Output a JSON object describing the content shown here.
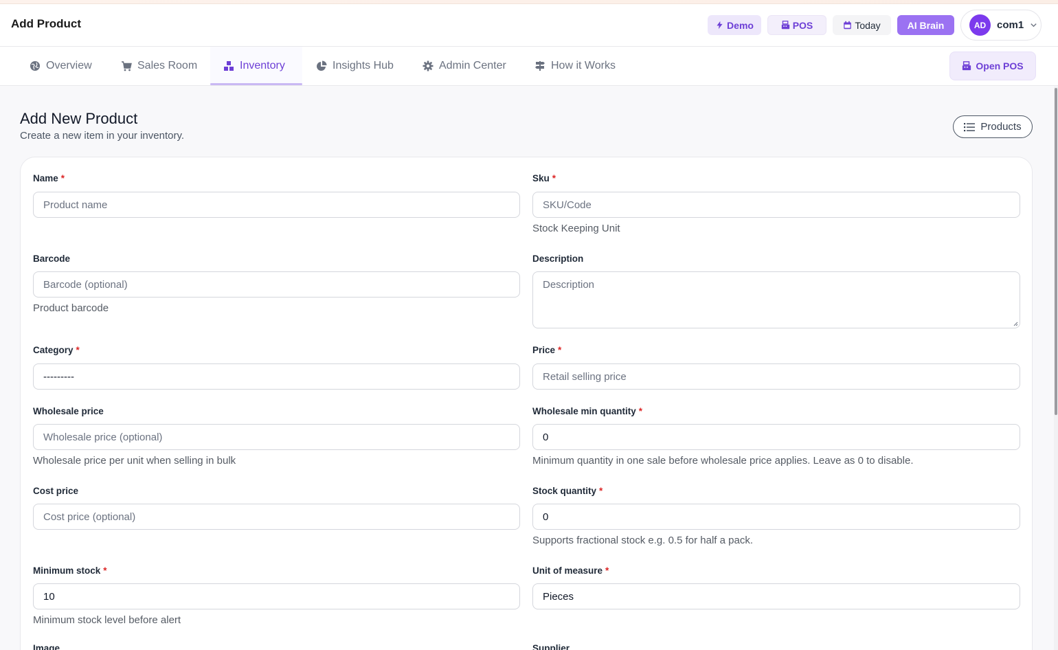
{
  "header": {
    "title": "Add Product",
    "demo_label": "Demo",
    "pos_label": "POS",
    "today_label": "Today",
    "ai_label": "AI Brain",
    "user_initials": "AD",
    "user_name": "com1"
  },
  "nav": {
    "tabs": [
      {
        "label": "Overview",
        "icon": "globe-icon"
      },
      {
        "label": "Sales Room",
        "icon": "cart-icon"
      },
      {
        "label": "Inventory",
        "icon": "boxes-icon",
        "active": true
      },
      {
        "label": "Insights Hub",
        "icon": "pie-chart-icon"
      },
      {
        "label": "Admin Center",
        "icon": "gear-icon"
      },
      {
        "label": "How it Works",
        "icon": "signpost-icon"
      }
    ],
    "open_pos_label": "Open POS"
  },
  "page": {
    "title": "Add New Product",
    "subtitle": "Create a new item in your inventory.",
    "products_button": "Products"
  },
  "form": {
    "name": {
      "label": "Name",
      "placeholder": "Product name"
    },
    "sku": {
      "label": "Sku",
      "placeholder": "SKU/Code",
      "help": "Stock Keeping Unit"
    },
    "barcode": {
      "label": "Barcode",
      "placeholder": "Barcode (optional)",
      "help": "Product barcode"
    },
    "description": {
      "label": "Description",
      "placeholder": "Description"
    },
    "category": {
      "label": "Category",
      "value": "---------"
    },
    "price": {
      "label": "Price",
      "placeholder": "Retail selling price"
    },
    "wholesale_price": {
      "label": "Wholesale price",
      "placeholder": "Wholesale price (optional)",
      "help": "Wholesale price per unit when selling in bulk"
    },
    "wholesale_min": {
      "label": "Wholesale min quantity",
      "value": "0",
      "help": "Minimum quantity in one sale before wholesale price applies. Leave as 0 to disable."
    },
    "cost_price": {
      "label": "Cost price",
      "placeholder": "Cost price (optional)"
    },
    "stock_quantity": {
      "label": "Stock quantity",
      "value": "0",
      "help": "Supports fractional stock e.g. 0.5 for half a pack."
    },
    "minimum_stock": {
      "label": "Minimum stock",
      "value": "10",
      "help": "Minimum stock level before alert"
    },
    "unit_of_measure": {
      "label": "Unit of measure",
      "value": "Pieces"
    },
    "image": {
      "label": "Image"
    },
    "supplier": {
      "label": "Supplier"
    },
    "required_mark": "*"
  },
  "colors": {
    "accent": "#6d3fd6",
    "ai_button": "#9b72f2",
    "required": "#dc2626"
  }
}
